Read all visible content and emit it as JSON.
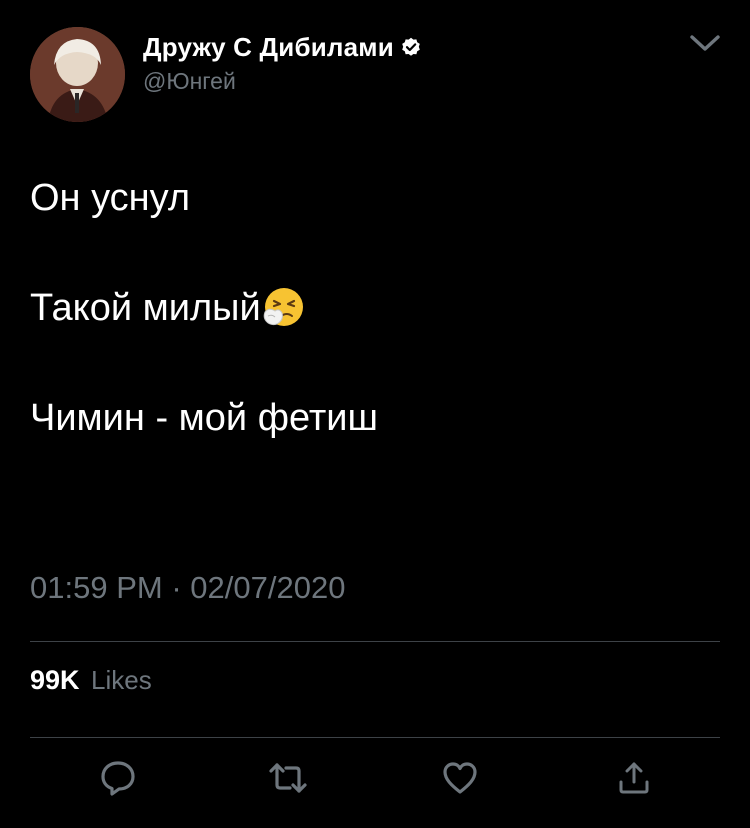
{
  "header": {
    "display_name": "Дружу С Дибилами",
    "handle": "@Юнгей",
    "verified": true
  },
  "tweet": {
    "lines": [
      "Он уснул",
      "Такой милый",
      "Чимин - мой фетиш"
    ],
    "emoji": "sneezing-face-icon"
  },
  "meta": {
    "time": "01:59 PM",
    "separator": "·",
    "date": "02/07/2020"
  },
  "stats": {
    "likes_count": "99K",
    "likes_label": "Likes"
  },
  "actions": [
    "reply-icon",
    "retweet-icon",
    "like-icon",
    "share-icon"
  ],
  "colors": {
    "background": "#000000",
    "text": "#ffffff",
    "secondary": "#6e767d",
    "divider": "#3d4247"
  }
}
